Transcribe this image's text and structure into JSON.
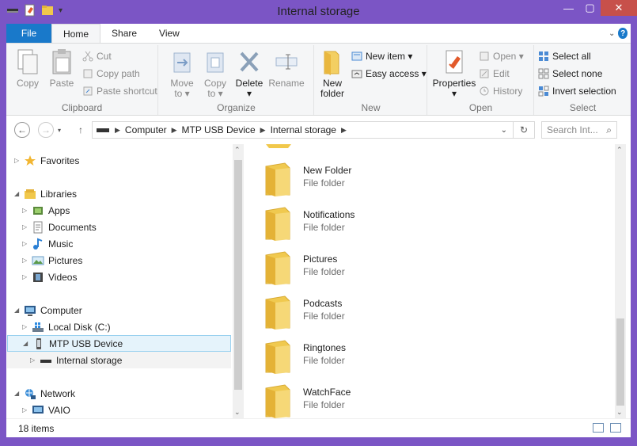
{
  "window": {
    "title": "Internal storage"
  },
  "tabs": {
    "file": "File",
    "home": "Home",
    "share": "Share",
    "view": "View",
    "help": "?"
  },
  "ribbon": {
    "clipboard": {
      "copy": "Copy",
      "paste": "Paste",
      "cut": "Cut",
      "copy_path": "Copy path",
      "paste_shortcut": "Paste shortcut",
      "label": "Clipboard"
    },
    "organize": {
      "move_to": "Move\nto ▾",
      "move_to_l1": "Move",
      "move_to_l2": "to ▾",
      "copy_to_l1": "Copy",
      "copy_to_l2": "to ▾",
      "delete_l1": "Delete",
      "delete_l2": "▾",
      "rename": "Rename",
      "label": "Organize"
    },
    "new": {
      "new_folder_l1": "New",
      "new_folder_l2": "folder",
      "new_item": "New item ▾",
      "easy_access": "Easy access ▾",
      "label": "New"
    },
    "open": {
      "properties": "Properties",
      "properties_arrow": "▾",
      "open": "Open ▾",
      "edit": "Edit",
      "history": "History",
      "label": "Open"
    },
    "select": {
      "select_all": "Select all",
      "select_none": "Select none",
      "invert": "Invert selection",
      "label": "Select"
    }
  },
  "address": {
    "computer": "Computer",
    "device": "MTP USB Device",
    "storage": "Internal storage",
    "search_placeholder": "Search Int..."
  },
  "nav": {
    "favorites": "Favorites",
    "libraries": "Libraries",
    "apps": "Apps",
    "documents": "Documents",
    "music": "Music",
    "pictures": "Pictures",
    "videos": "Videos",
    "computer": "Computer",
    "local_disk": "Local Disk (C:)",
    "mtp": "MTP USB Device",
    "internal": "Internal storage",
    "network": "Network",
    "vaio": "VAIO"
  },
  "files": [
    {
      "name": "New Folder",
      "type": "File folder"
    },
    {
      "name": "Notifications",
      "type": "File folder"
    },
    {
      "name": "Pictures",
      "type": "File folder"
    },
    {
      "name": "Podcasts",
      "type": "File folder"
    },
    {
      "name": "Ringtones",
      "type": "File folder"
    },
    {
      "name": "WatchFace",
      "type": "File folder"
    }
  ],
  "status": {
    "count": "18 items"
  },
  "colors": {
    "accent": "#1979ca",
    "frame": "#7b55c5",
    "close": "#c7504a",
    "selection": "#e5f3fb"
  }
}
